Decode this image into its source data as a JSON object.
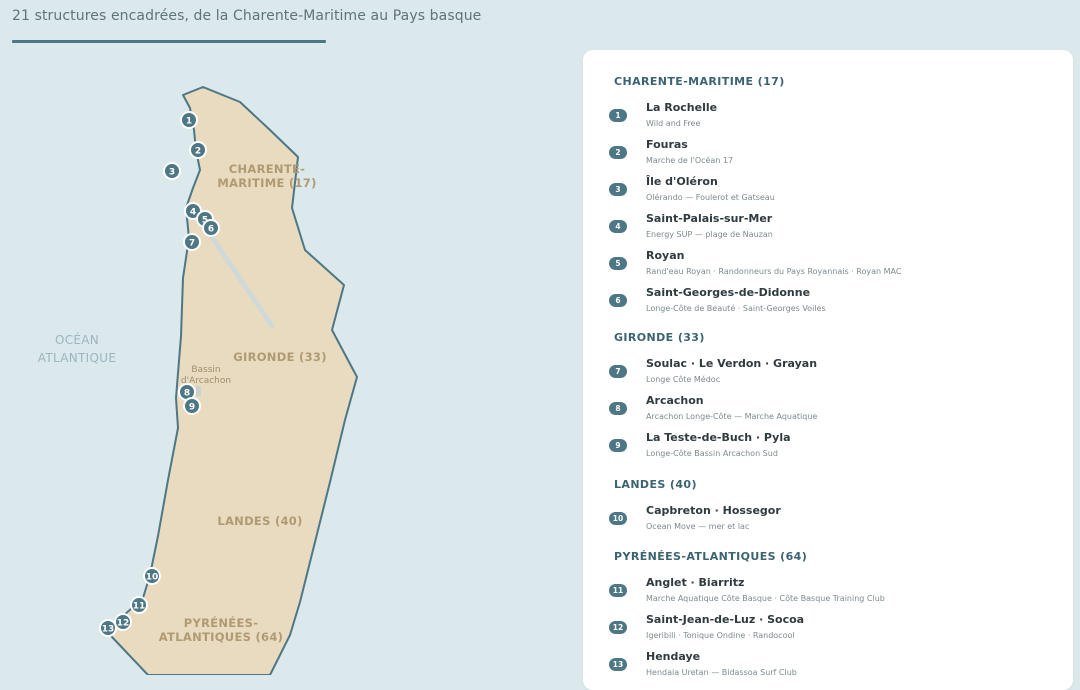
{
  "header": {
    "title": "21 structures encadrées, de la Charente-Maritime au Pays basque"
  },
  "map": {
    "ocean_label": [
      "OCÉAN",
      "ATLANTIQUE"
    ],
    "bassin_label": [
      "Bassin",
      "d'Arcachon"
    ],
    "region_labels": {
      "charente": [
        "CHARENTE-",
        "MARITIME (17)"
      ],
      "gironde": "GIRONDE (33)",
      "landes": "LANDES (40)",
      "pyrenees": [
        "PYRÉNÉES-",
        "ATLANTIQUES (64)"
      ]
    },
    "markers": [
      "1",
      "2",
      "3",
      "4",
      "5",
      "6",
      "7",
      "8",
      "9",
      "10",
      "11",
      "12",
      "13"
    ]
  },
  "panel": {
    "regions": [
      {
        "heading": "CHARENTE-MARITIME (17)",
        "entries": [
          {
            "num": "1",
            "name": "La Rochelle",
            "sub": "Wild and Free"
          },
          {
            "num": "2",
            "name": "Fouras",
            "sub": "Marche de l'Océan 17"
          },
          {
            "num": "3",
            "name": "Île d'Oléron",
            "sub": "Olérando — Foulerot et Gatseau"
          },
          {
            "num": "4",
            "name": "Saint-Palais-sur-Mer",
            "sub": "Energy SUP — plage de Nauzan"
          },
          {
            "num": "5",
            "name": "Royan",
            "sub": "Rand'eau Royan · Randonneurs du Pays Royannais · Royan MAC"
          },
          {
            "num": "6",
            "name": "Saint-Georges-de-Didonne",
            "sub": "Longe-Côte de Beauté · Saint-Georges Voiles"
          }
        ]
      },
      {
        "heading": "GIRONDE (33)",
        "entries": [
          {
            "num": "7",
            "name": "Soulac · Le Verdon · Grayan",
            "sub": "Longe Côte Médoc"
          },
          {
            "num": "8",
            "name": "Arcachon",
            "sub": "Arcachon Longe-Côte — Marche Aquatique"
          },
          {
            "num": "9",
            "name": "La Teste-de-Buch · Pyla",
            "sub": "Longe-Côte Bassin Arcachon Sud"
          }
        ]
      },
      {
        "heading": "LANDES (40)",
        "entries": [
          {
            "num": "10",
            "name": "Capbreton · Hossegor",
            "sub": "Ocean Move — mer et lac"
          }
        ]
      },
      {
        "heading": "PYRÉNÉES-ATLANTIQUES (64)",
        "entries": [
          {
            "num": "11",
            "name": "Anglet · Biarritz",
            "sub": "Marche Aquatique Côte Basque · Côte Basque Training Club"
          },
          {
            "num": "12",
            "name": "Saint-Jean-de-Luz · Socoa",
            "sub": "Igeribili · Tonique Ondine · Randocool"
          },
          {
            "num": "13",
            "name": "Hendaye",
            "sub": "Hendaia Uretan — Bidassoa Surf Club"
          }
        ]
      }
    ]
  },
  "colors": {
    "ocean": "#dbe8ec",
    "land": "#e9dbc0",
    "coast": "#4d7785",
    "marker": "#4d7785",
    "region_label": "#b09a72",
    "heading": "#3b6473"
  }
}
